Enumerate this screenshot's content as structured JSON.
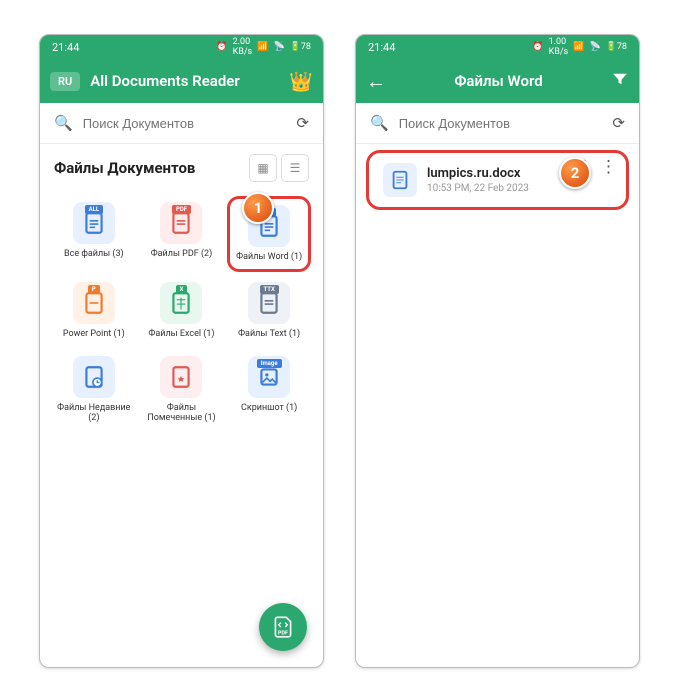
{
  "statusbar": {
    "time": "21:44",
    "net_left": "2.00",
    "net_left_unit": "KB/s",
    "net_right": "1.00",
    "net_right_unit": "KB/s",
    "battery": "78"
  },
  "left": {
    "ru": "RU",
    "title": "All Documents Reader",
    "search_placeholder": "Поиск Документов",
    "section_title": "Файлы Документов",
    "categories": [
      {
        "label": "Все файлы (3)",
        "tag": "ALL",
        "bg": "#e6f0ff",
        "accent": "#3b7dd8"
      },
      {
        "label": "Файлы PDF (2)",
        "tag": "PDF",
        "bg": "#ffecec",
        "accent": "#e05a4f"
      },
      {
        "label": "Файлы Word (1)",
        "tag": "W",
        "bg": "#e6f0ff",
        "accent": "#3b7dd8"
      },
      {
        "label": "Power Point (1)",
        "tag": "P",
        "bg": "#fff1e6",
        "accent": "#ef7b2f"
      },
      {
        "label": "Файлы Excel (1)",
        "tag": "X",
        "bg": "#e9f8ef",
        "accent": "#2ba86f"
      },
      {
        "label": "Файлы Text (1)",
        "tag": "TTX",
        "bg": "#eef1f5",
        "accent": "#6b7a8f"
      },
      {
        "label": "Файлы Недавние (2)",
        "tag": "",
        "bg": "#e6f0ff",
        "accent": "#3b7dd8"
      },
      {
        "label": "Файлы Помеченные (1)",
        "tag": "",
        "bg": "#fdeef0",
        "accent": "#e05a4f"
      },
      {
        "label": "Скриншот (1)",
        "tag": "Image",
        "bg": "#e6f0ff",
        "accent": "#3b7dd8"
      }
    ]
  },
  "right": {
    "title": "Файлы Word",
    "search_placeholder": "Поиск Документов",
    "file": {
      "name": "lumpics.ru.docx",
      "meta": "10:53 PM, 22 Feb 2023"
    }
  },
  "steps": {
    "one": "1",
    "two": "2"
  }
}
